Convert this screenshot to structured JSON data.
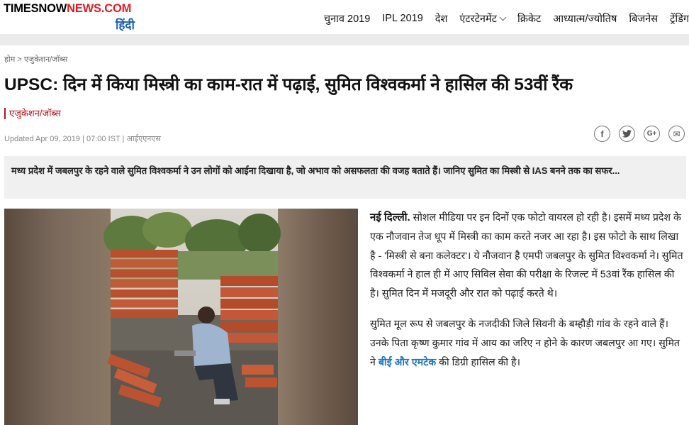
{
  "site": {
    "logo_part1": "TIMESNOW",
    "logo_part2": "NEWS.COM",
    "logo_sub": "हिंदी",
    "brand_red": "#e41b23",
    "brand_blue": "#1a5fb4"
  },
  "nav": {
    "items": [
      "चुनाव 2019",
      "IPL 2019",
      "देश",
      "एंटरटेनमेंट",
      "क्रिकेट",
      "आध्यात्म/ज्योतिष",
      "बिजनेस",
      "ट्रेंडिंग"
    ]
  },
  "breadcrumb": {
    "home": "होम",
    "sep": ">",
    "section": "एजुकेशन/जॉब्स"
  },
  "article": {
    "headline": "UPSC: दिन में किया मिस्त्री का काम-रात में पढ़ाई, सुमित विश्वकर्मा ने हासिल की 53वीं रैंक",
    "category": "एजुकेशन/जॉब्स",
    "meta": "Updated Apr 09, 2019 | 07:00 IST | आईएएनएस",
    "summary": "मध्य प्रदेश में जबलपुर के रहने वाले सुमित विश्वकर्मा ने उन लोगों को आईना दिखाया है, जो अभाव को असफलता की वजह बताते हैं। जानिए सुमित का मिस्त्री से IAS बनने तक का सफर...",
    "dateline": "नई दिल्ली.",
    "para1": " सोशल मीडिया पर इन दिनों एक फोटो  वायरल हो रही है। इसमें मध्य प्रदेश के एक नौजवान तेज धूप में मिस्त्री का काम करते नजर आ रहा है। इस फोटो के साथ लिखा है - 'मिस्त्री से बना कलेक्टर'। ये नौजवान है एमपी जबलपुर के सुमित विश्वकर्मा ने। सुमित विश्वकर्मा ने हाल ही में आए सिविल सेवा की परीक्षा के रिजल्ट में 53वां रैंक हासिल की है। सुमित दिन में मजदूरी और रात को पढ़ाई करते थे।",
    "para2_before": "सुमित मूल रूप से जबलपुर के नजदीकी जिले सिवनी के बम्हौड़ी गांव के रहने वाले हैं। उनके पिता कृष्ण कुमार गांव में आय का जरिए न होने के कारण जबलपुर आ गए। सुमित ने ",
    "para2_link": "बीई और एमटेक",
    "para2_after": " की डिग्री हासिल की है।"
  },
  "share": {
    "icons": [
      "facebook-icon",
      "twitter-icon",
      "google-plus-icon",
      "email-icon"
    ],
    "glyphs": [
      "f",
      "t",
      "G+",
      "✉"
    ]
  }
}
